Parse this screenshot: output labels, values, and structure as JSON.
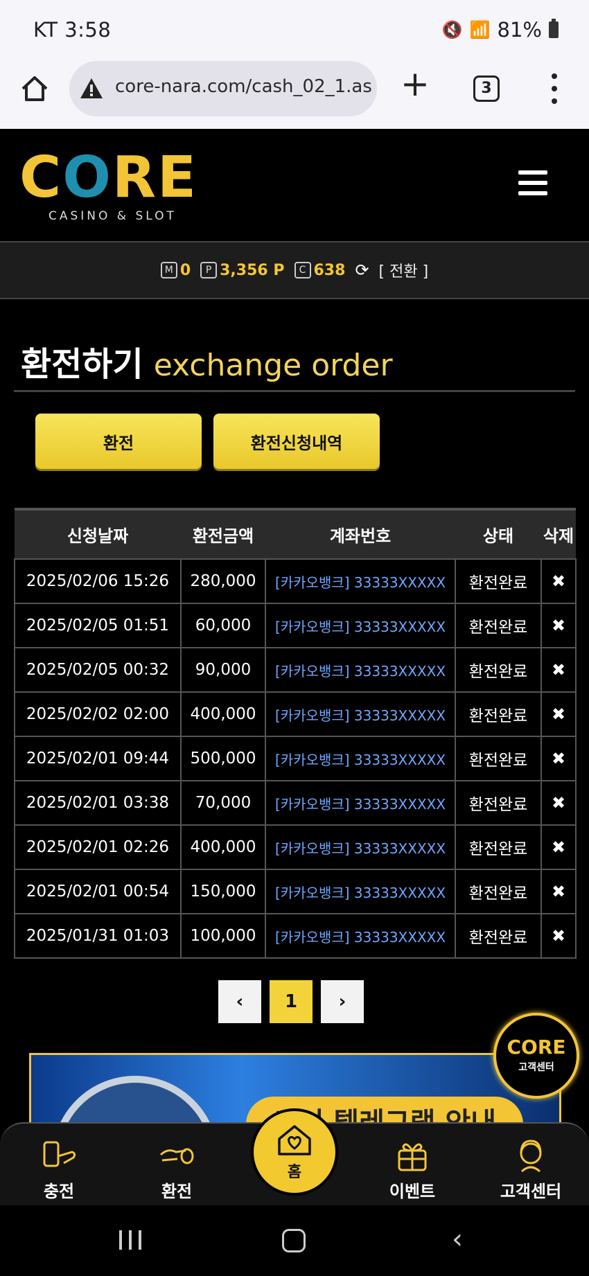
{
  "status_bar": {
    "carrier_time": "KT 3:58",
    "battery": "81%"
  },
  "browser": {
    "url": "core-nara.com/cash_02_1.asp",
    "tab_count": "3"
  },
  "site": {
    "logo_text": "CORE",
    "logo_sub": "CASINO & SLOT"
  },
  "balance": {
    "m_label": "M",
    "m_value": "0",
    "p_label": "P",
    "p_value": "3,356 P",
    "c_label": "C",
    "c_value": "638",
    "convert_label": "[ 전환 ]"
  },
  "page": {
    "title_ko": "환전하기",
    "title_en": "exchange order"
  },
  "buttons": {
    "exchange": "환전",
    "history": "환전신청내역"
  },
  "table": {
    "headers": [
      "신청날짜",
      "환전금액",
      "계좌번호",
      "상태",
      "삭제"
    ],
    "rows": [
      {
        "date": "2025/02/06 15:26",
        "amount": "280,000",
        "account": "[카카오뱅크] 33333XXXXX",
        "status": "환전완료",
        "delete": "✖"
      },
      {
        "date": "2025/02/05 01:51",
        "amount": "60,000",
        "account": "[카카오뱅크] 33333XXXXX",
        "status": "환전완료",
        "delete": "✖"
      },
      {
        "date": "2025/02/05 00:32",
        "amount": "90,000",
        "account": "[카카오뱅크] 33333XXXXX",
        "status": "환전완료",
        "delete": "✖"
      },
      {
        "date": "2025/02/02 02:00",
        "amount": "400,000",
        "account": "[카카오뱅크] 33333XXXXX",
        "status": "환전완료",
        "delete": "✖"
      },
      {
        "date": "2025/02/01 09:44",
        "amount": "500,000",
        "account": "[카카오뱅크] 33333XXXXX",
        "status": "환전완료",
        "delete": "✖"
      },
      {
        "date": "2025/02/01 03:38",
        "amount": "70,000",
        "account": "[카카오뱅크] 33333XXXXX",
        "status": "환전완료",
        "delete": "✖"
      },
      {
        "date": "2025/02/01 02:26",
        "amount": "400,000",
        "account": "[카카오뱅크] 33333XXXXX",
        "status": "환전완료",
        "delete": "✖"
      },
      {
        "date": "2025/02/01 00:54",
        "amount": "150,000",
        "account": "[카카오뱅크] 33333XXXXX",
        "status": "환전완료",
        "delete": "✖"
      },
      {
        "date": "2025/01/31 01:03",
        "amount": "100,000",
        "account": "[카카오뱅크] 33333XXXXX",
        "status": "환전완료",
        "delete": "✖"
      }
    ]
  },
  "pagination": {
    "prev": "‹",
    "current": "1",
    "next": "›"
  },
  "banner": {
    "text": "코어 텔레그램 안내"
  },
  "floating_cs": {
    "logo": "CORE",
    "label": "고객센터"
  },
  "bottom_nav": {
    "charge": "충전",
    "exchange": "환전",
    "home": "홈",
    "event": "이벤트",
    "support": "고객센터"
  },
  "colors": {
    "accent": "#f3c536",
    "link": "#6fa6ff",
    "background": "#000000"
  }
}
